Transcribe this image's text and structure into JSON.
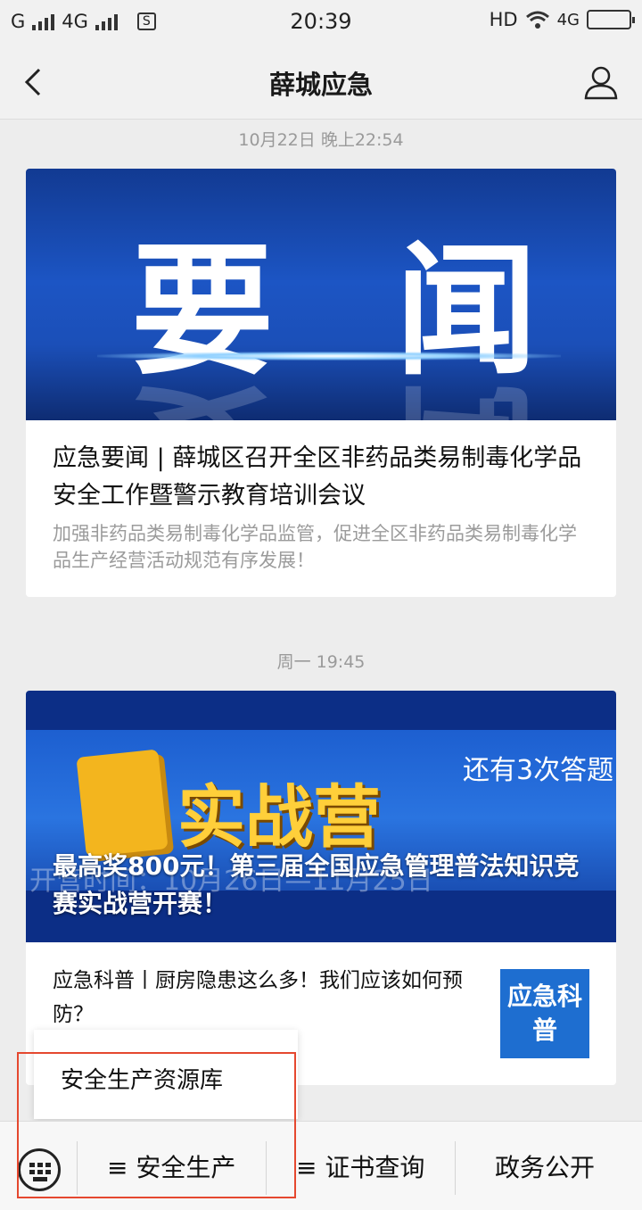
{
  "status": {
    "carrier": "G",
    "network": "4G",
    "sim_icon": "S",
    "time": "20:39",
    "hd": "HD",
    "net2": "4G"
  },
  "header": {
    "title": "薛城应急"
  },
  "feed": [
    {
      "timestamp": "10月22日 晚上22:54",
      "banner_word_1": "要",
      "banner_word_2": "闻",
      "title": "应急要闻 | 薛城区召开全区非药品类易制毒化学品安全工作暨警示教育培训会议",
      "desc": "加强非药品类易制毒化学品监管，促进全区非药品类易制毒化学品生产经营活动规范有序发展！"
    },
    {
      "timestamp": "周一 19:45",
      "banner_word": "实战营",
      "banner_corner": "还有3次答题",
      "banner_under": "开营时间：10月26日—11月25日",
      "title": "最高奖800元！第三届全国应急管理普法知识竞赛实战营开赛！",
      "sub_title": "应急科普丨厨房隐患这么多！我们应该如何预防？",
      "thumb_text": "应急科普"
    }
  ],
  "popup": {
    "item": "安全生产资源库"
  },
  "menu": {
    "item1": "≡ 安全生产",
    "item2": "≡ 证书查询",
    "item3": "政务公开"
  }
}
